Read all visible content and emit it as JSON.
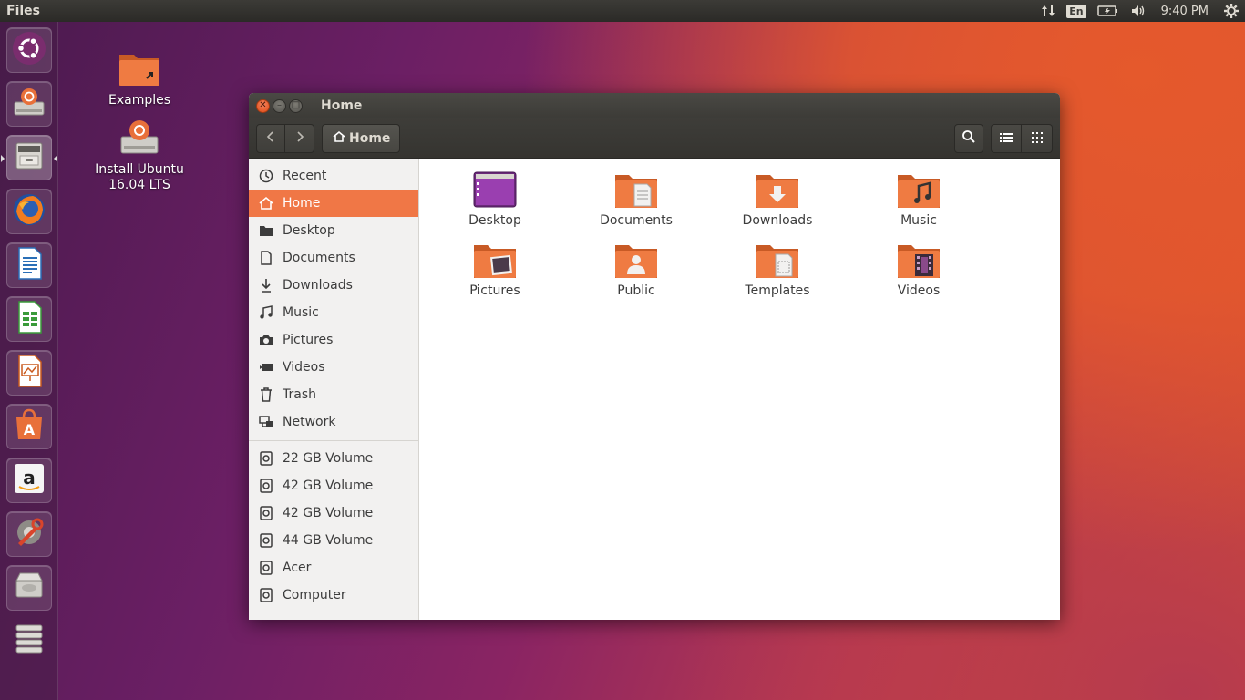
{
  "top_panel": {
    "app_name": "Files",
    "language": "En",
    "clock": "9:40 PM"
  },
  "launcher": {
    "items": [
      {
        "name": "dash-home",
        "icon": "ubuntu-logo-icon"
      },
      {
        "name": "install-ubuntu",
        "icon": "installer-icon"
      },
      {
        "name": "files",
        "icon": "file-cabinet-icon"
      },
      {
        "name": "firefox",
        "icon": "firefox-icon"
      },
      {
        "name": "libreoffice-writer",
        "icon": "writer-icon"
      },
      {
        "name": "libreoffice-calc",
        "icon": "calc-icon"
      },
      {
        "name": "libreoffice-impress",
        "icon": "impress-icon"
      },
      {
        "name": "ubuntu-software",
        "icon": "software-center-icon"
      },
      {
        "name": "amazon",
        "icon": "amazon-icon"
      },
      {
        "name": "system-settings",
        "icon": "settings-wrench-icon"
      },
      {
        "name": "drive",
        "icon": "hard-drive-icon"
      },
      {
        "name": "drives-stack",
        "icon": "hard-drive-stack-icon"
      }
    ]
  },
  "desktop": {
    "icons": [
      {
        "label": "Examples"
      },
      {
        "label": "Install Ubuntu\n16.04 LTS"
      }
    ]
  },
  "window": {
    "title": "Home",
    "path_button": "Home",
    "sidebar": {
      "places": [
        {
          "label": "Recent",
          "icon": "clock-icon"
        },
        {
          "label": "Home",
          "icon": "home-icon",
          "active": true
        },
        {
          "label": "Desktop",
          "icon": "folder-icon"
        },
        {
          "label": "Documents",
          "icon": "document-icon"
        },
        {
          "label": "Downloads",
          "icon": "download-icon"
        },
        {
          "label": "Music",
          "icon": "music-icon"
        },
        {
          "label": "Pictures",
          "icon": "camera-icon"
        },
        {
          "label": "Videos",
          "icon": "video-icon"
        },
        {
          "label": "Trash",
          "icon": "trash-icon"
        },
        {
          "label": "Network",
          "icon": "network-icon"
        }
      ],
      "devices": [
        {
          "label": "22 GB Volume",
          "icon": "drive-icon"
        },
        {
          "label": "42 GB Volume",
          "icon": "drive-icon"
        },
        {
          "label": "42 GB Volume",
          "icon": "drive-icon"
        },
        {
          "label": "44 GB Volume",
          "icon": "drive-icon"
        },
        {
          "label": "Acer",
          "icon": "drive-icon"
        },
        {
          "label": "Computer",
          "icon": "drive-icon"
        }
      ]
    },
    "files": [
      {
        "label": "Desktop",
        "icon": "desktop-folder-icon"
      },
      {
        "label": "Documents",
        "icon": "documents-folder-icon"
      },
      {
        "label": "Downloads",
        "icon": "downloads-folder-icon"
      },
      {
        "label": "Music",
        "icon": "music-folder-icon"
      },
      {
        "label": "Pictures",
        "icon": "pictures-folder-icon"
      },
      {
        "label": "Public",
        "icon": "public-folder-icon"
      },
      {
        "label": "Templates",
        "icon": "templates-folder-icon"
      },
      {
        "label": "Videos",
        "icon": "videos-folder-icon"
      }
    ]
  },
  "colors": {
    "accent": "#f07746",
    "folder": "#e8703a",
    "panel": "#3c3b37"
  }
}
